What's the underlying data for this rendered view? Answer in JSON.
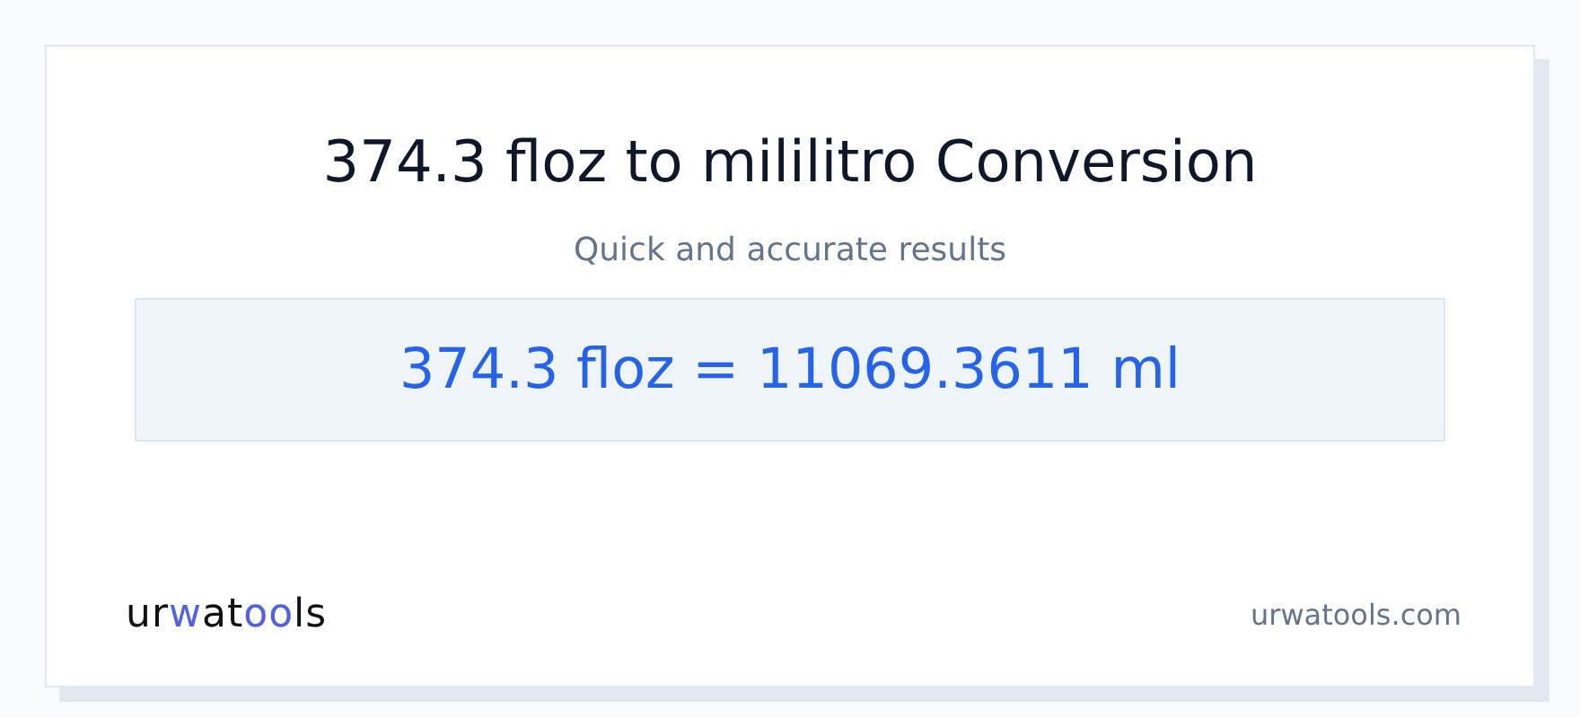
{
  "title": "374.3 floz to mililitro Conversion",
  "subtitle": "Quick and accurate results",
  "result": "374.3 floz = 11069.3611 ml",
  "footer": {
    "logo": [
      {
        "text": "ur",
        "accent": false
      },
      {
        "text": "w",
        "accent": true
      },
      {
        "text": "at",
        "accent": false
      },
      {
        "text": "oo",
        "accent": true
      },
      {
        "text": "ls",
        "accent": false
      }
    ],
    "site": "urwatools.com"
  }
}
